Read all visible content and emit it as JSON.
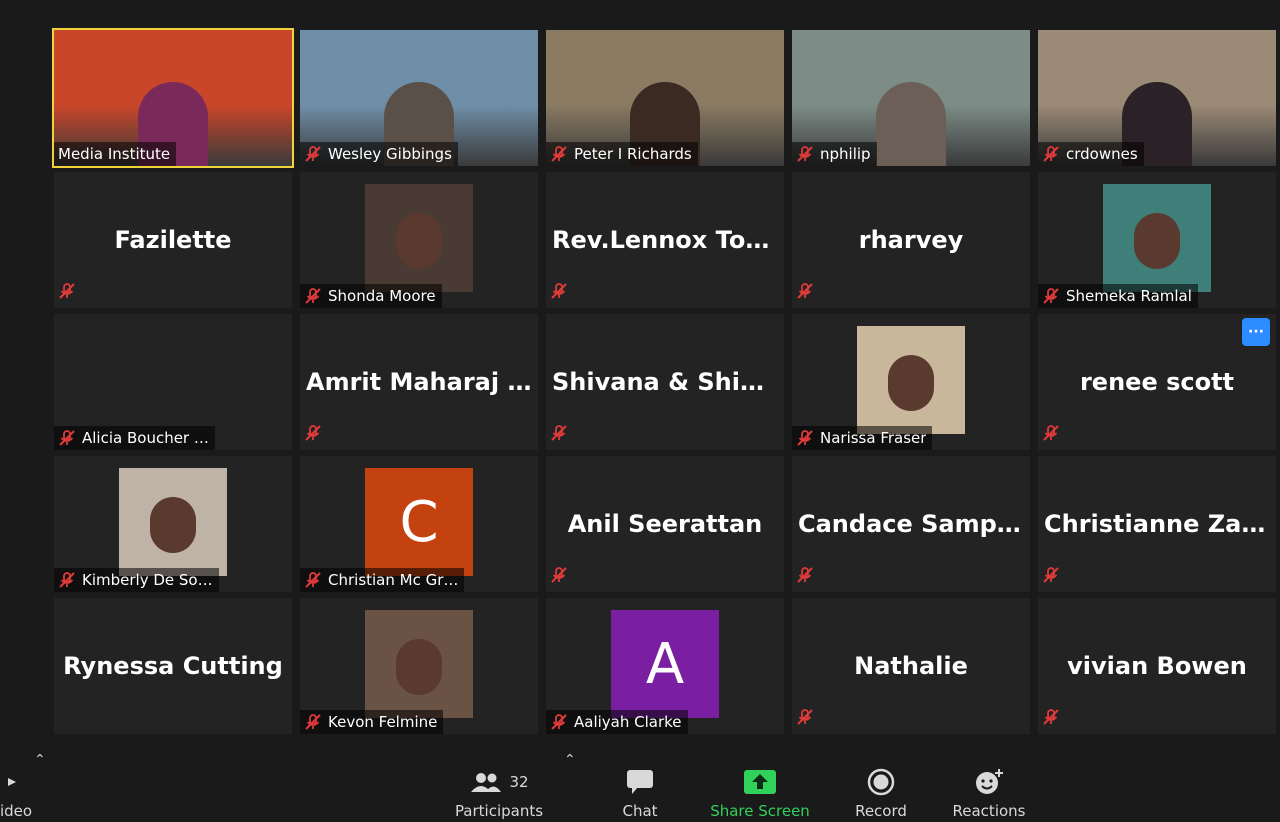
{
  "participants": [
    {
      "name": "Media Institute",
      "type": "video",
      "muted": false,
      "active": true,
      "bg": "#c9462a",
      "thumb": "#7a2a5a"
    },
    {
      "name": "Wesley Gibbings",
      "type": "video",
      "muted": true,
      "bg": "#6f8fa8",
      "thumb": "#5b5048"
    },
    {
      "name": "Peter I Richards",
      "type": "video",
      "muted": true,
      "bg": "#8a7b62",
      "thumb": "#3a2a22"
    },
    {
      "name": "nphilip",
      "type": "video",
      "muted": true,
      "bg": "#7d8c86",
      "thumb": "#6b5f58"
    },
    {
      "name": "crdownes",
      "type": "video",
      "muted": true,
      "bg": "#9b8a76",
      "thumb": "#2a2226"
    },
    {
      "name": "Fazilette",
      "type": "name",
      "muted": true
    },
    {
      "name": "Shonda Moore",
      "type": "photo",
      "muted": true,
      "thumb": "#4a3a34"
    },
    {
      "name": "Rev.Lennox  Tou…",
      "type": "name",
      "muted": true
    },
    {
      "name": "rharvey",
      "type": "name",
      "muted": true
    },
    {
      "name": "Shemeka Ramlal",
      "type": "photo",
      "muted": true,
      "thumb": "#3f7f7a"
    },
    {
      "name": "Alicia Boucher …",
      "type": "blank",
      "muted": true
    },
    {
      "name": "Amrit  Maharaj  -…",
      "type": "name",
      "muted": true
    },
    {
      "name": "Shivana  &  Shiv…",
      "type": "name",
      "muted": true
    },
    {
      "name": "Narissa Fraser",
      "type": "photo",
      "muted": true,
      "thumb": "#c8b79a"
    },
    {
      "name": "renee scott",
      "type": "name",
      "muted": true,
      "more": "···"
    },
    {
      "name": "Kimberly De So…",
      "type": "photo",
      "muted": true,
      "thumb": "#bfb3a8"
    },
    {
      "name": "Christian Mc Gr…",
      "type": "letter",
      "letter": "C",
      "color": "#c4420f",
      "muted": true
    },
    {
      "name": "Anil Seerattan",
      "type": "name",
      "muted": true
    },
    {
      "name": "Candace  Samps…",
      "type": "name",
      "muted": true
    },
    {
      "name": "Christianne  Zak…",
      "type": "name",
      "muted": true
    },
    {
      "name": "Rynessa Cutting",
      "type": "name",
      "muted": false
    },
    {
      "name": "Kevon Felmine",
      "type": "photo",
      "muted": true,
      "thumb": "#6a5244"
    },
    {
      "name": "Aaliyah Clarke",
      "type": "letter",
      "letter": "A",
      "color": "#7a1fa2",
      "muted": true
    },
    {
      "name": "Nathalie",
      "type": "name",
      "muted": true
    },
    {
      "name": "vivian Bowen",
      "type": "name",
      "muted": true
    }
  ],
  "toolbar": {
    "video_label": "ideo",
    "participants_label": "Participants",
    "participants_count": "32",
    "chat_label": "Chat",
    "share_label": "Share Screen",
    "record_label": "Record",
    "reactions_label": "Reactions"
  },
  "colors": {
    "accent_share": "#2fd15b",
    "active_border": "#f0d33a",
    "mute_red": "#e03a3a"
  }
}
